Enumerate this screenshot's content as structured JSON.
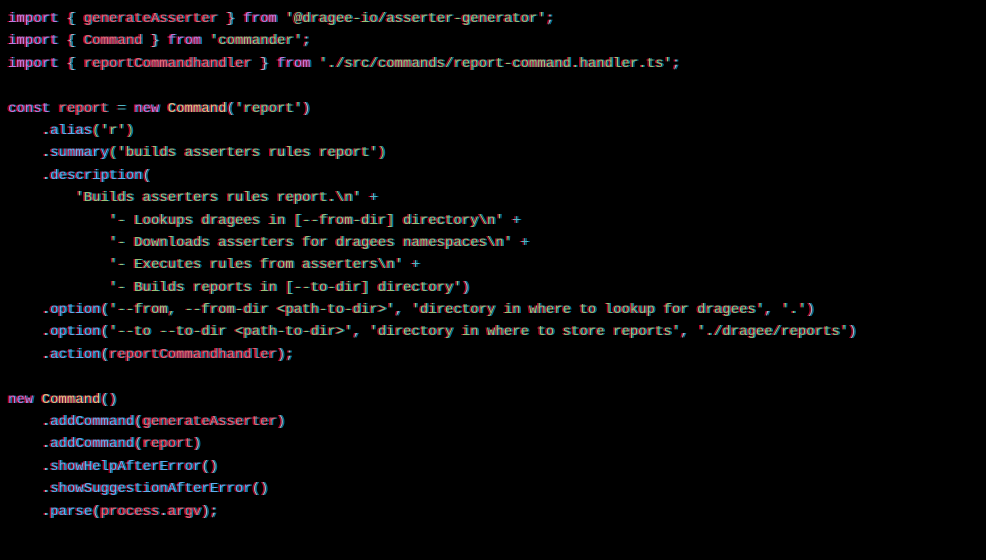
{
  "lines": {
    "l1_import": "import",
    "l1_brace_o": " { ",
    "l1_var": "generateAsserter",
    "l1_brace_c": " } ",
    "l1_from": "from",
    "l1_str": " '@dragee-io/asserter-generator'",
    "l1_semi": ";",
    "l2_import": "import",
    "l2_brace_o": " { ",
    "l2_var": "Command",
    "l2_brace_c": " } ",
    "l2_from": "from",
    "l2_str": " 'commander'",
    "l2_semi": ";",
    "l3_import": "import",
    "l3_brace_o": " { ",
    "l3_var": "reportCommandhandler",
    "l3_brace_c": " } ",
    "l3_from": "from",
    "l3_str": " './src/commands/report-command.handler.ts'",
    "l3_semi": ";",
    "l5_const": "const ",
    "l5_var": "report",
    "l5_eq": " = ",
    "l5_new": "new ",
    "l5_cls": "Command",
    "l5_paren": "(",
    "l5_str": "'report'",
    "l5_close": ")",
    "l6_indent": "    .",
    "l6_fn": "alias",
    "l6_args": "('r')",
    "l7_indent": "    .",
    "l7_fn": "summary",
    "l7_args": "('builds asserters rules report')",
    "l8_indent": "    .",
    "l8_fn": "description",
    "l8_paren": "(",
    "l9_indent": "        ",
    "l9_str": "'Builds asserters rules report.\\n'",
    "l9_plus": " +",
    "l10_indent": "            ",
    "l10_str": "'- Lookups dragees in [--from-dir] directory\\n'",
    "l10_plus": " +",
    "l11_indent": "            ",
    "l11_str": "'- Downloads asserters for dragees namespaces\\n'",
    "l11_plus": " +",
    "l12_indent": "            ",
    "l12_str": "'- Executes rules from asserters\\n'",
    "l12_plus": " +",
    "l13_indent": "            ",
    "l13_str": "'- Builds reports in [--to-dir] directory'",
    "l13_close": ")",
    "l14_indent": "    .",
    "l14_fn": "option",
    "l14_paren": "(",
    "l14_str1": "'--from, --from-dir <path-to-dir>'",
    "l14_c1": ", ",
    "l14_str2": "'directory in where to lookup for dragees'",
    "l14_c2": ", ",
    "l14_str3": "'.'",
    "l14_close": ")",
    "l15_indent": "    .",
    "l15_fn": "option",
    "l15_paren": "(",
    "l15_str1": "'--to --to-dir <path-to-dir>'",
    "l15_c1": ", ",
    "l15_str2": "'directory in where to store reports'",
    "l15_c2": ", ",
    "l15_str3": "'./dragee/reports'",
    "l15_close": ")",
    "l16_indent": "    .",
    "l16_fn": "action",
    "l16_paren": "(",
    "l16_var": "reportCommandhandler",
    "l16_close": ");",
    "l18_new": "new ",
    "l18_cls": "Command",
    "l18_args": "()",
    "l19_indent": "    .",
    "l19_fn": "addCommand",
    "l19_paren": "(",
    "l19_var": "generateAsserter",
    "l19_close": ")",
    "l20_indent": "    .",
    "l20_fn": "addCommand",
    "l20_paren": "(",
    "l20_var": "report",
    "l20_close": ")",
    "l21_indent": "    .",
    "l21_fn": "showHelpAfterError",
    "l21_args": "()",
    "l22_indent": "    .",
    "l22_fn": "showSuggestionAfterError",
    "l22_args": "()",
    "l23_indent": "    .",
    "l23_fn": "parse",
    "l23_paren": "(",
    "l23_var1": "process",
    "l23_dot": ".",
    "l23_var2": "argv",
    "l23_close": ");"
  }
}
